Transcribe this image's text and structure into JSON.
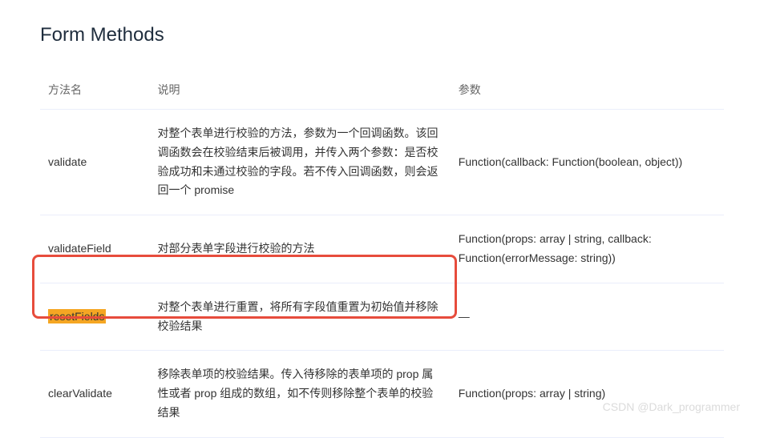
{
  "title": "Form Methods",
  "headers": {
    "name": "方法名",
    "desc": "说明",
    "param": "参数"
  },
  "rows": [
    {
      "name": "validate",
      "desc": "对整个表单进行校验的方法，参数为一个回调函数。该回调函数会在校验结束后被调用，并传入两个参数：是否校验成功和未通过校验的字段。若不传入回调函数，则会返回一个 promise",
      "param": "Function(callback: Function(boolean, object))"
    },
    {
      "name": "validateField",
      "desc": "对部分表单字段进行校验的方法",
      "param": "Function(props: array | string, callback: Function(errorMessage: string))"
    },
    {
      "name": "resetFields",
      "desc": "对整个表单进行重置，将所有字段值重置为初始值并移除校验结果",
      "param": "—"
    },
    {
      "name": "clearValidate",
      "desc": "移除表单项的校验结果。传入待移除的表单项的 prop 属性或者 prop 组成的数组，如不传则移除整个表单的校验结果",
      "param": "Function(props: array | string)"
    }
  ],
  "watermark": "CSDN @Dark_programmer"
}
